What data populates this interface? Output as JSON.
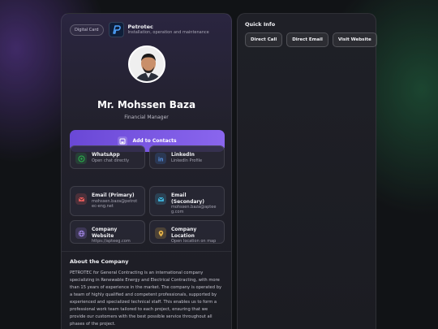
{
  "card": {
    "badge": "Digital Card",
    "brand_name": "Petrotec",
    "brand_sub": "Installation, operation and maintenance",
    "name": "Mr. Mohssen Baza",
    "role": "Financial Manager",
    "add_contact": "Add to Contacts",
    "tiles": [
      {
        "title": "WhatsApp",
        "sub": "Open chat directly",
        "icon": "whatsapp-icon",
        "color": "#2bb24c"
      },
      {
        "title": "LinkedIn",
        "sub": "LinkedIn Profile",
        "icon": "linkedin-icon",
        "color": "#3b7bd6"
      },
      {
        "title": "Email (Primary)",
        "sub": "mohssen.baza@petrotec-eng.net",
        "icon": "mail-icon",
        "color": "#e05a5a"
      },
      {
        "title": "Email (Secondary)",
        "sub": "mohssen.baza@apteeg.com",
        "icon": "mail-icon",
        "color": "#3fb0d8"
      },
      {
        "title": "Company Website",
        "sub": "https://apteeg.com",
        "icon": "globe-icon",
        "color": "#9b7fe6"
      },
      {
        "title": "Company Location",
        "sub": "Open location on map",
        "icon": "location-pin-icon",
        "color": "#e5b34a"
      }
    ],
    "about_title": "About the Company",
    "about_text": "PETROTEC for General Contracting is an international company specializing in Renewable Energy and Electrical Contracting, with more than 15 years of experience in the market. The company is operated by a team of highly qualified and competent professionals, supported by experienced and specialized technical staff. This enables us to form a professional work team tailored to each project, ensuring that we provide our customers with the best possible service throughout all phases of the project."
  },
  "quick_info": {
    "title": "Quick Info",
    "buttons": [
      "Direct Call",
      "Direct Email",
      "Visit Website"
    ]
  },
  "colors": {
    "accent": "#7a58e6",
    "background": "#111316"
  }
}
